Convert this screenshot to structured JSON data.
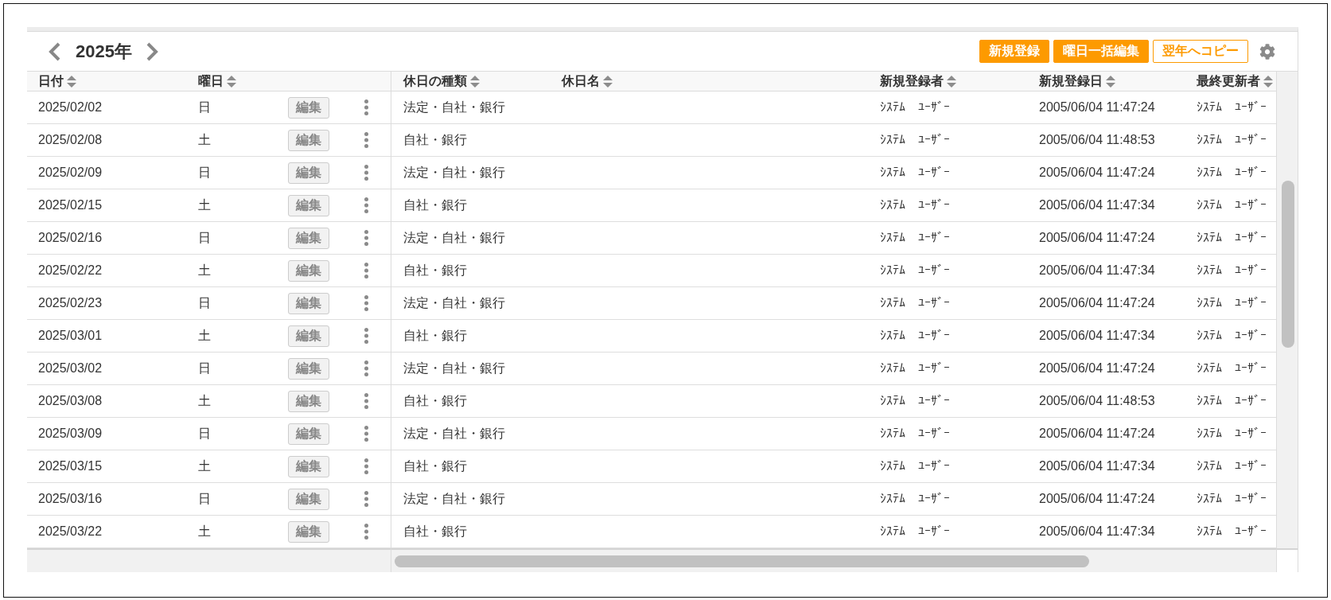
{
  "year_nav": {
    "title": "2025年"
  },
  "toolbar": {
    "buttons": [
      {
        "label": "新規登録",
        "kind": "primary"
      },
      {
        "label": "曜日一括編集",
        "kind": "primary"
      },
      {
        "label": "翌年へコピー",
        "kind": "outline"
      }
    ]
  },
  "table": {
    "columns": [
      {
        "label": "日付"
      },
      {
        "label": "曜日"
      },
      {
        "label": "休日の種類"
      },
      {
        "label": "休日名"
      },
      {
        "label": "新規登録者"
      },
      {
        "label": "新規登録日"
      },
      {
        "label": "最終更新者"
      }
    ],
    "rows": [
      {
        "date": "2025/02/02",
        "weekday": "日",
        "edit_label": "編集",
        "holiday_type": "法定・自社・銀行",
        "created_by": "ｼｽﾃﾑ　ﾕｰｻﾞｰ",
        "created_at": "2005/06/04 11:47:24",
        "updated_by": "ｼｽﾃﾑ　ﾕｰｻﾞｰ"
      },
      {
        "date": "2025/02/08",
        "weekday": "土",
        "edit_label": "編集",
        "holiday_type": "自社・銀行",
        "created_by": "ｼｽﾃﾑ　ﾕｰｻﾞｰ",
        "created_at": "2005/06/04 11:48:53",
        "updated_by": "ｼｽﾃﾑ　ﾕｰｻﾞｰ"
      },
      {
        "date": "2025/02/09",
        "weekday": "日",
        "edit_label": "編集",
        "holiday_type": "法定・自社・銀行",
        "created_by": "ｼｽﾃﾑ　ﾕｰｻﾞｰ",
        "created_at": "2005/06/04 11:47:24",
        "updated_by": "ｼｽﾃﾑ　ﾕｰｻﾞｰ"
      },
      {
        "date": "2025/02/15",
        "weekday": "土",
        "edit_label": "編集",
        "holiday_type": "自社・銀行",
        "created_by": "ｼｽﾃﾑ　ﾕｰｻﾞｰ",
        "created_at": "2005/06/04 11:47:34",
        "updated_by": "ｼｽﾃﾑ　ﾕｰｻﾞｰ"
      },
      {
        "date": "2025/02/16",
        "weekday": "日",
        "edit_label": "編集",
        "holiday_type": "法定・自社・銀行",
        "created_by": "ｼｽﾃﾑ　ﾕｰｻﾞｰ",
        "created_at": "2005/06/04 11:47:24",
        "updated_by": "ｼｽﾃﾑ　ﾕｰｻﾞｰ"
      },
      {
        "date": "2025/02/22",
        "weekday": "土",
        "edit_label": "編集",
        "holiday_type": "自社・銀行",
        "created_by": "ｼｽﾃﾑ　ﾕｰｻﾞｰ",
        "created_at": "2005/06/04 11:47:34",
        "updated_by": "ｼｽﾃﾑ　ﾕｰｻﾞｰ"
      },
      {
        "date": "2025/02/23",
        "weekday": "日",
        "edit_label": "編集",
        "holiday_type": "法定・自社・銀行",
        "created_by": "ｼｽﾃﾑ　ﾕｰｻﾞｰ",
        "created_at": "2005/06/04 11:47:24",
        "updated_by": "ｼｽﾃﾑ　ﾕｰｻﾞｰ"
      },
      {
        "date": "2025/03/01",
        "weekday": "土",
        "edit_label": "編集",
        "holiday_type": "自社・銀行",
        "created_by": "ｼｽﾃﾑ　ﾕｰｻﾞｰ",
        "created_at": "2005/06/04 11:47:34",
        "updated_by": "ｼｽﾃﾑ　ﾕｰｻﾞｰ"
      },
      {
        "date": "2025/03/02",
        "weekday": "日",
        "edit_label": "編集",
        "holiday_type": "法定・自社・銀行",
        "created_by": "ｼｽﾃﾑ　ﾕｰｻﾞｰ",
        "created_at": "2005/06/04 11:47:24",
        "updated_by": "ｼｽﾃﾑ　ﾕｰｻﾞｰ"
      },
      {
        "date": "2025/03/08",
        "weekday": "土",
        "edit_label": "編集",
        "holiday_type": "自社・銀行",
        "created_by": "ｼｽﾃﾑ　ﾕｰｻﾞｰ",
        "created_at": "2005/06/04 11:48:53",
        "updated_by": "ｼｽﾃﾑ　ﾕｰｻﾞｰ"
      },
      {
        "date": "2025/03/09",
        "weekday": "日",
        "edit_label": "編集",
        "holiday_type": "法定・自社・銀行",
        "created_by": "ｼｽﾃﾑ　ﾕｰｻﾞｰ",
        "created_at": "2005/06/04 11:47:24",
        "updated_by": "ｼｽﾃﾑ　ﾕｰｻﾞｰ"
      },
      {
        "date": "2025/03/15",
        "weekday": "土",
        "edit_label": "編集",
        "holiday_type": "自社・銀行",
        "created_by": "ｼｽﾃﾑ　ﾕｰｻﾞｰ",
        "created_at": "2005/06/04 11:47:34",
        "updated_by": "ｼｽﾃﾑ　ﾕｰｻﾞｰ"
      },
      {
        "date": "2025/03/16",
        "weekday": "日",
        "edit_label": "編集",
        "holiday_type": "法定・自社・銀行",
        "created_by": "ｼｽﾃﾑ　ﾕｰｻﾞｰ",
        "created_at": "2005/06/04 11:47:24",
        "updated_by": "ｼｽﾃﾑ　ﾕｰｻﾞｰ"
      },
      {
        "date": "2025/03/22",
        "weekday": "土",
        "edit_label": "編集",
        "holiday_type": "自社・銀行",
        "created_by": "ｼｽﾃﾑ　ﾕｰｻﾞｰ",
        "created_at": "2005/06/04 11:47:34",
        "updated_by": "ｼｽﾃﾑ　ﾕｰｻﾞｰ"
      }
    ]
  }
}
